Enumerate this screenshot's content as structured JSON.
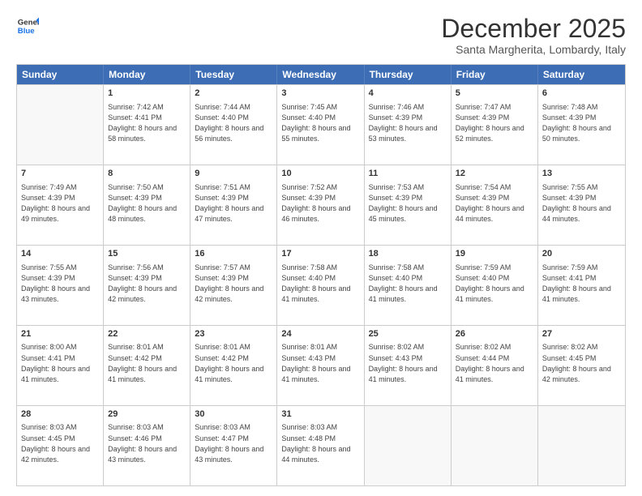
{
  "logo": {
    "line1": "General",
    "line2": "Blue"
  },
  "header": {
    "month": "December 2025",
    "location": "Santa Margherita, Lombardy, Italy"
  },
  "weekdays": [
    "Sunday",
    "Monday",
    "Tuesday",
    "Wednesday",
    "Thursday",
    "Friday",
    "Saturday"
  ],
  "rows": [
    [
      {
        "day": "",
        "sunrise": "",
        "sunset": "",
        "daylight": "",
        "empty": true
      },
      {
        "day": "1",
        "sunrise": "Sunrise: 7:42 AM",
        "sunset": "Sunset: 4:41 PM",
        "daylight": "Daylight: 8 hours and 58 minutes."
      },
      {
        "day": "2",
        "sunrise": "Sunrise: 7:44 AM",
        "sunset": "Sunset: 4:40 PM",
        "daylight": "Daylight: 8 hours and 56 minutes."
      },
      {
        "day": "3",
        "sunrise": "Sunrise: 7:45 AM",
        "sunset": "Sunset: 4:40 PM",
        "daylight": "Daylight: 8 hours and 55 minutes."
      },
      {
        "day": "4",
        "sunrise": "Sunrise: 7:46 AM",
        "sunset": "Sunset: 4:39 PM",
        "daylight": "Daylight: 8 hours and 53 minutes."
      },
      {
        "day": "5",
        "sunrise": "Sunrise: 7:47 AM",
        "sunset": "Sunset: 4:39 PM",
        "daylight": "Daylight: 8 hours and 52 minutes."
      },
      {
        "day": "6",
        "sunrise": "Sunrise: 7:48 AM",
        "sunset": "Sunset: 4:39 PM",
        "daylight": "Daylight: 8 hours and 50 minutes."
      }
    ],
    [
      {
        "day": "7",
        "sunrise": "Sunrise: 7:49 AM",
        "sunset": "Sunset: 4:39 PM",
        "daylight": "Daylight: 8 hours and 49 minutes."
      },
      {
        "day": "8",
        "sunrise": "Sunrise: 7:50 AM",
        "sunset": "Sunset: 4:39 PM",
        "daylight": "Daylight: 8 hours and 48 minutes."
      },
      {
        "day": "9",
        "sunrise": "Sunrise: 7:51 AM",
        "sunset": "Sunset: 4:39 PM",
        "daylight": "Daylight: 8 hours and 47 minutes."
      },
      {
        "day": "10",
        "sunrise": "Sunrise: 7:52 AM",
        "sunset": "Sunset: 4:39 PM",
        "daylight": "Daylight: 8 hours and 46 minutes."
      },
      {
        "day": "11",
        "sunrise": "Sunrise: 7:53 AM",
        "sunset": "Sunset: 4:39 PM",
        "daylight": "Daylight: 8 hours and 45 minutes."
      },
      {
        "day": "12",
        "sunrise": "Sunrise: 7:54 AM",
        "sunset": "Sunset: 4:39 PM",
        "daylight": "Daylight: 8 hours and 44 minutes."
      },
      {
        "day": "13",
        "sunrise": "Sunrise: 7:55 AM",
        "sunset": "Sunset: 4:39 PM",
        "daylight": "Daylight: 8 hours and 44 minutes."
      }
    ],
    [
      {
        "day": "14",
        "sunrise": "Sunrise: 7:55 AM",
        "sunset": "Sunset: 4:39 PM",
        "daylight": "Daylight: 8 hours and 43 minutes."
      },
      {
        "day": "15",
        "sunrise": "Sunrise: 7:56 AM",
        "sunset": "Sunset: 4:39 PM",
        "daylight": "Daylight: 8 hours and 42 minutes."
      },
      {
        "day": "16",
        "sunrise": "Sunrise: 7:57 AM",
        "sunset": "Sunset: 4:39 PM",
        "daylight": "Daylight: 8 hours and 42 minutes."
      },
      {
        "day": "17",
        "sunrise": "Sunrise: 7:58 AM",
        "sunset": "Sunset: 4:40 PM",
        "daylight": "Daylight: 8 hours and 41 minutes."
      },
      {
        "day": "18",
        "sunrise": "Sunrise: 7:58 AM",
        "sunset": "Sunset: 4:40 PM",
        "daylight": "Daylight: 8 hours and 41 minutes."
      },
      {
        "day": "19",
        "sunrise": "Sunrise: 7:59 AM",
        "sunset": "Sunset: 4:40 PM",
        "daylight": "Daylight: 8 hours and 41 minutes."
      },
      {
        "day": "20",
        "sunrise": "Sunrise: 7:59 AM",
        "sunset": "Sunset: 4:41 PM",
        "daylight": "Daylight: 8 hours and 41 minutes."
      }
    ],
    [
      {
        "day": "21",
        "sunrise": "Sunrise: 8:00 AM",
        "sunset": "Sunset: 4:41 PM",
        "daylight": "Daylight: 8 hours and 41 minutes."
      },
      {
        "day": "22",
        "sunrise": "Sunrise: 8:01 AM",
        "sunset": "Sunset: 4:42 PM",
        "daylight": "Daylight: 8 hours and 41 minutes."
      },
      {
        "day": "23",
        "sunrise": "Sunrise: 8:01 AM",
        "sunset": "Sunset: 4:42 PM",
        "daylight": "Daylight: 8 hours and 41 minutes."
      },
      {
        "day": "24",
        "sunrise": "Sunrise: 8:01 AM",
        "sunset": "Sunset: 4:43 PM",
        "daylight": "Daylight: 8 hours and 41 minutes."
      },
      {
        "day": "25",
        "sunrise": "Sunrise: 8:02 AM",
        "sunset": "Sunset: 4:43 PM",
        "daylight": "Daylight: 8 hours and 41 minutes."
      },
      {
        "day": "26",
        "sunrise": "Sunrise: 8:02 AM",
        "sunset": "Sunset: 4:44 PM",
        "daylight": "Daylight: 8 hours and 41 minutes."
      },
      {
        "day": "27",
        "sunrise": "Sunrise: 8:02 AM",
        "sunset": "Sunset: 4:45 PM",
        "daylight": "Daylight: 8 hours and 42 minutes."
      }
    ],
    [
      {
        "day": "28",
        "sunrise": "Sunrise: 8:03 AM",
        "sunset": "Sunset: 4:45 PM",
        "daylight": "Daylight: 8 hours and 42 minutes."
      },
      {
        "day": "29",
        "sunrise": "Sunrise: 8:03 AM",
        "sunset": "Sunset: 4:46 PM",
        "daylight": "Daylight: 8 hours and 43 minutes."
      },
      {
        "day": "30",
        "sunrise": "Sunrise: 8:03 AM",
        "sunset": "Sunset: 4:47 PM",
        "daylight": "Daylight: 8 hours and 43 minutes."
      },
      {
        "day": "31",
        "sunrise": "Sunrise: 8:03 AM",
        "sunset": "Sunset: 4:48 PM",
        "daylight": "Daylight: 8 hours and 44 minutes."
      },
      {
        "day": "",
        "sunrise": "",
        "sunset": "",
        "daylight": "",
        "empty": true
      },
      {
        "day": "",
        "sunrise": "",
        "sunset": "",
        "daylight": "",
        "empty": true
      },
      {
        "day": "",
        "sunrise": "",
        "sunset": "",
        "daylight": "",
        "empty": true
      }
    ]
  ]
}
